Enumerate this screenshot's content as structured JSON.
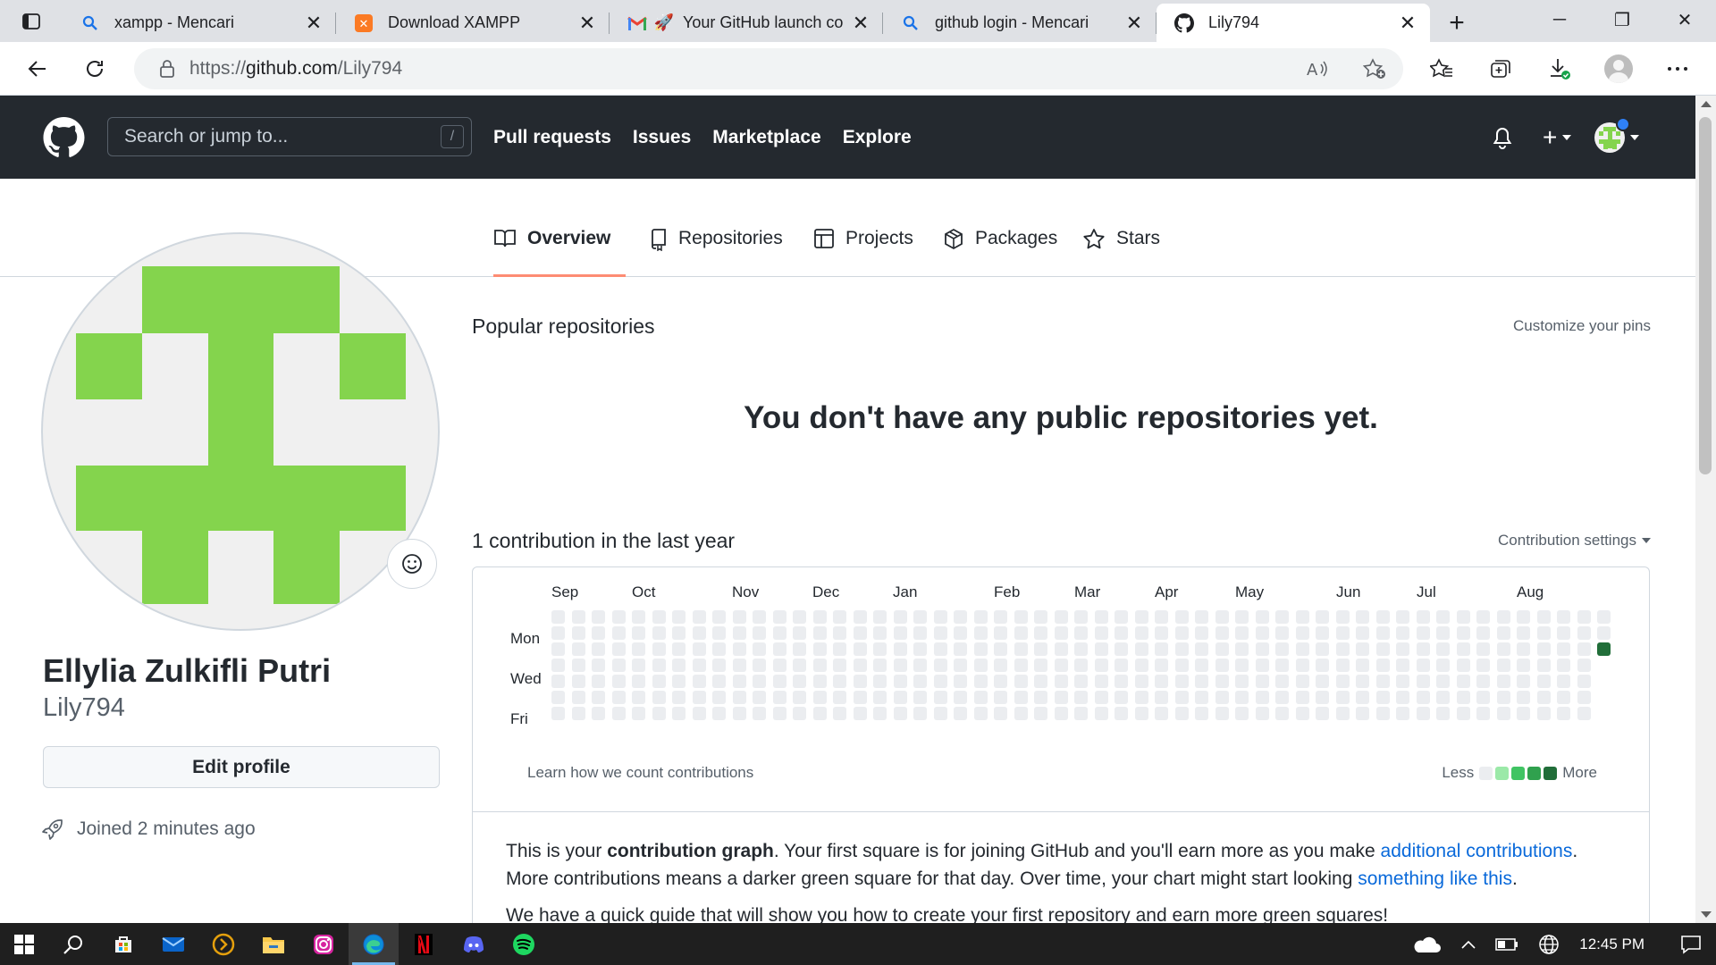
{
  "browser": {
    "tabs": [
      {
        "title": "xampp - Mencari",
        "icon": "search-icon"
      },
      {
        "title": "Download XAMPP",
        "icon": "xampp-icon"
      },
      {
        "title": "Your GitHub launch co",
        "icon": "gmail-icon"
      },
      {
        "title": "github login - Mencari",
        "icon": "search-icon"
      },
      {
        "title": "Lily794",
        "icon": "github-icon"
      }
    ],
    "url_prefix": "https://",
    "url_host": "github.com",
    "url_path": "/Lily794"
  },
  "github": {
    "search_placeholder": "Search or jump to...",
    "search_shortcut": "/",
    "nav": [
      "Pull requests",
      "Issues",
      "Marketplace",
      "Explore"
    ],
    "plus_label": "+"
  },
  "profile_tabs": [
    "Overview",
    "Repositories",
    "Projects",
    "Packages",
    "Stars"
  ],
  "profile": {
    "full_name": "Ellylia Zulkifli Putri",
    "username": "Lily794",
    "edit_button": "Edit profile",
    "joined": "Joined 2 minutes ago"
  },
  "main": {
    "popular_title": "Popular repositories",
    "customize_pins": "Customize your pins",
    "no_repos": "You don't have any public repositories yet.",
    "contrib_title": "1 contribution in the last year",
    "contrib_settings": "Contribution settings",
    "months": [
      "Sep",
      "Oct",
      "Nov",
      "Dec",
      "Jan",
      "Feb",
      "Mar",
      "Apr",
      "May",
      "Jun",
      "Jul",
      "Aug"
    ],
    "days": [
      "Mon",
      "Wed",
      "Fri"
    ],
    "learn_link": "Learn how we count contributions",
    "legend_less": "Less",
    "legend_more": "More",
    "legend_colors": [
      "#ebedf0",
      "#9be9a8",
      "#40c463",
      "#30a14e",
      "#216e39"
    ],
    "explain_p1_a": "This is your ",
    "explain_p1_bold": "contribution graph",
    "explain_p1_b": ". Your first square is for joining GitHub and you'll earn more as you make ",
    "explain_link1": "additional contributions",
    "explain_p1_c": ".",
    "explain_p2_a": "More contributions means a darker green square for that day. Over time, your chart might start looking ",
    "explain_link2": "something like this",
    "explain_p2_b": ".",
    "explain_p3": "We have a quick guide that will show you how to create your first repository and earn more green squares!"
  },
  "contributions": {
    "weeks": 53,
    "last_week_days": 3,
    "active_day": {
      "week": 52,
      "day": 2,
      "level": 4
    }
  },
  "taskbar": {
    "time": "12:45 PM",
    "apps": [
      "windows-start-icon",
      "search-icon",
      "store-icon",
      "mail-icon",
      "plex-icon",
      "file-explorer-icon",
      "instagram-icon",
      "edge-icon",
      "netflix-icon",
      "discord-icon",
      "spotify-icon"
    ]
  },
  "colors": {
    "header_bg": "#24292f",
    "link": "#0969da",
    "tab_underline": "#fd8c73",
    "avatar_green": "#84d44d"
  }
}
